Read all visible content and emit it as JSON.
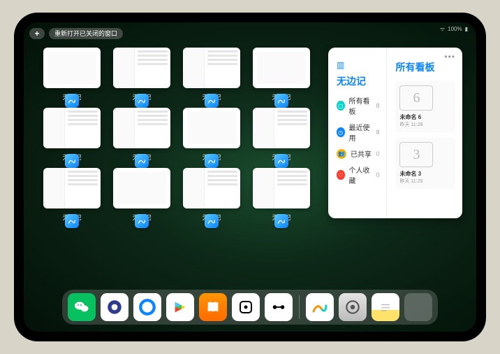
{
  "status": {
    "battery": "100%"
  },
  "controls": {
    "plus": "+",
    "reopen": "重新打开已关闭的窗口"
  },
  "windows": [
    {
      "label": "无边记",
      "kind": "blank"
    },
    {
      "label": "无边记",
      "kind": "list"
    },
    {
      "label": "无边记",
      "kind": "list"
    },
    {
      "label": "无边记",
      "kind": "blank"
    },
    {
      "label": "无边记",
      "kind": "list"
    },
    {
      "label": "无边记",
      "kind": "list"
    },
    {
      "label": "无边记",
      "kind": "blank"
    },
    {
      "label": "无边记",
      "kind": "list"
    },
    {
      "label": "无边记",
      "kind": "list"
    },
    {
      "label": "无边记",
      "kind": "blank"
    },
    {
      "label": "无边记",
      "kind": "list"
    },
    {
      "label": "无边记",
      "kind": "list"
    }
  ],
  "panel": {
    "left_title": "无边记",
    "right_title": "所有看板",
    "items": [
      {
        "icon_bg": "#0ad3c8",
        "glyph": "▢",
        "label": "所有看板",
        "count": "8"
      },
      {
        "icon_bg": "#0a84ff",
        "glyph": "◷",
        "label": "最近使用",
        "count": "8"
      },
      {
        "icon_bg": "#ffb300",
        "glyph": "👥",
        "label": "已共享",
        "count": "0"
      },
      {
        "icon_bg": "#ff3b30",
        "glyph": "♡",
        "label": "个人收藏",
        "count": "0"
      }
    ],
    "cards": [
      {
        "sketch": "6",
        "title": "未命名 6",
        "sub": "昨天 11:28"
      },
      {
        "sketch": "3",
        "title": "未命名 3",
        "sub": "昨天 11:25"
      }
    ]
  },
  "dock": [
    {
      "name": "wechat",
      "cls": "di-wechat"
    },
    {
      "name": "uc",
      "cls": "di-uc"
    },
    {
      "name": "qqbrowser",
      "cls": "di-qq"
    },
    {
      "name": "play",
      "cls": "di-play"
    },
    {
      "name": "books",
      "cls": "di-books"
    },
    {
      "name": "dice",
      "cls": "di-dice"
    },
    {
      "name": "xmind",
      "cls": "di-xm"
    },
    {
      "name": "freeform",
      "cls": "di-freeform"
    },
    {
      "name": "settings",
      "cls": "di-settings"
    },
    {
      "name": "notes",
      "cls": "di-notes"
    },
    {
      "name": "app-library",
      "cls": "di-apptray"
    }
  ]
}
